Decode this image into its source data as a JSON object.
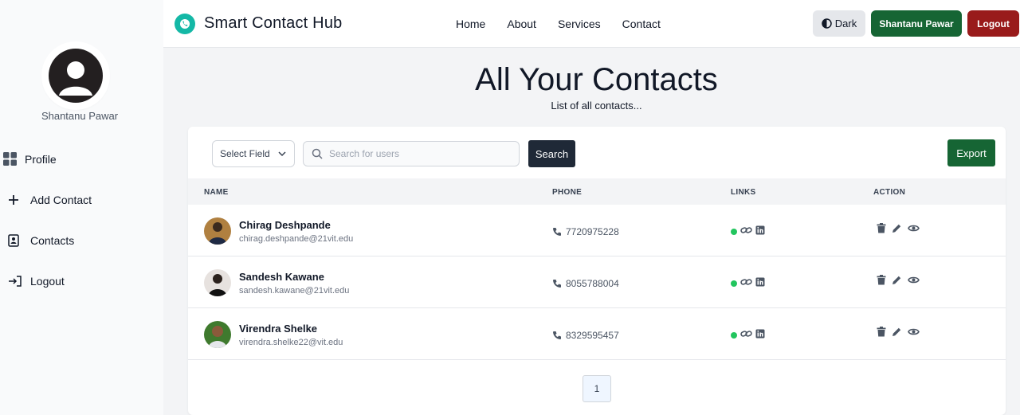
{
  "header": {
    "brand": "Smart Contact Hub",
    "nav": [
      "Home",
      "About",
      "Services",
      "Contact"
    ],
    "dark_label": "Dark",
    "user_label": "Shantanu Pawar",
    "logout_label": "Logout",
    "colors": {
      "accent": "#14b8a6",
      "user_button": "#166534",
      "logout_button": "#991b1b"
    }
  },
  "sidebar": {
    "user_name": "Shantanu Pawar",
    "items": [
      {
        "label": "Profile",
        "icon": "grid-icon"
      },
      {
        "label": "Add Contact",
        "icon": "plus-icon"
      },
      {
        "label": "Contacts",
        "icon": "contact-card-icon"
      },
      {
        "label": "Logout",
        "icon": "logout-icon"
      }
    ]
  },
  "main": {
    "title": "All Your Contacts",
    "subtitle": "List of all contacts...",
    "select_label": "Select Field",
    "search_placeholder": "Search for users",
    "search_label": "Search",
    "export_label": "Export",
    "columns": [
      "NAME",
      "PHONE",
      "LINKS",
      "ACTION"
    ],
    "contacts": [
      {
        "name": "Chirag Deshpande",
        "email": "chirag.deshpande@21vit.edu",
        "phone": "7720975228"
      },
      {
        "name": "Sandesh Kawane",
        "email": "sandesh.kawane@21vit.edu",
        "phone": "8055788004"
      },
      {
        "name": "Virendra Shelke",
        "email": "virendra.shelke22@vit.edu",
        "phone": "8329595457"
      }
    ],
    "page": "1"
  }
}
